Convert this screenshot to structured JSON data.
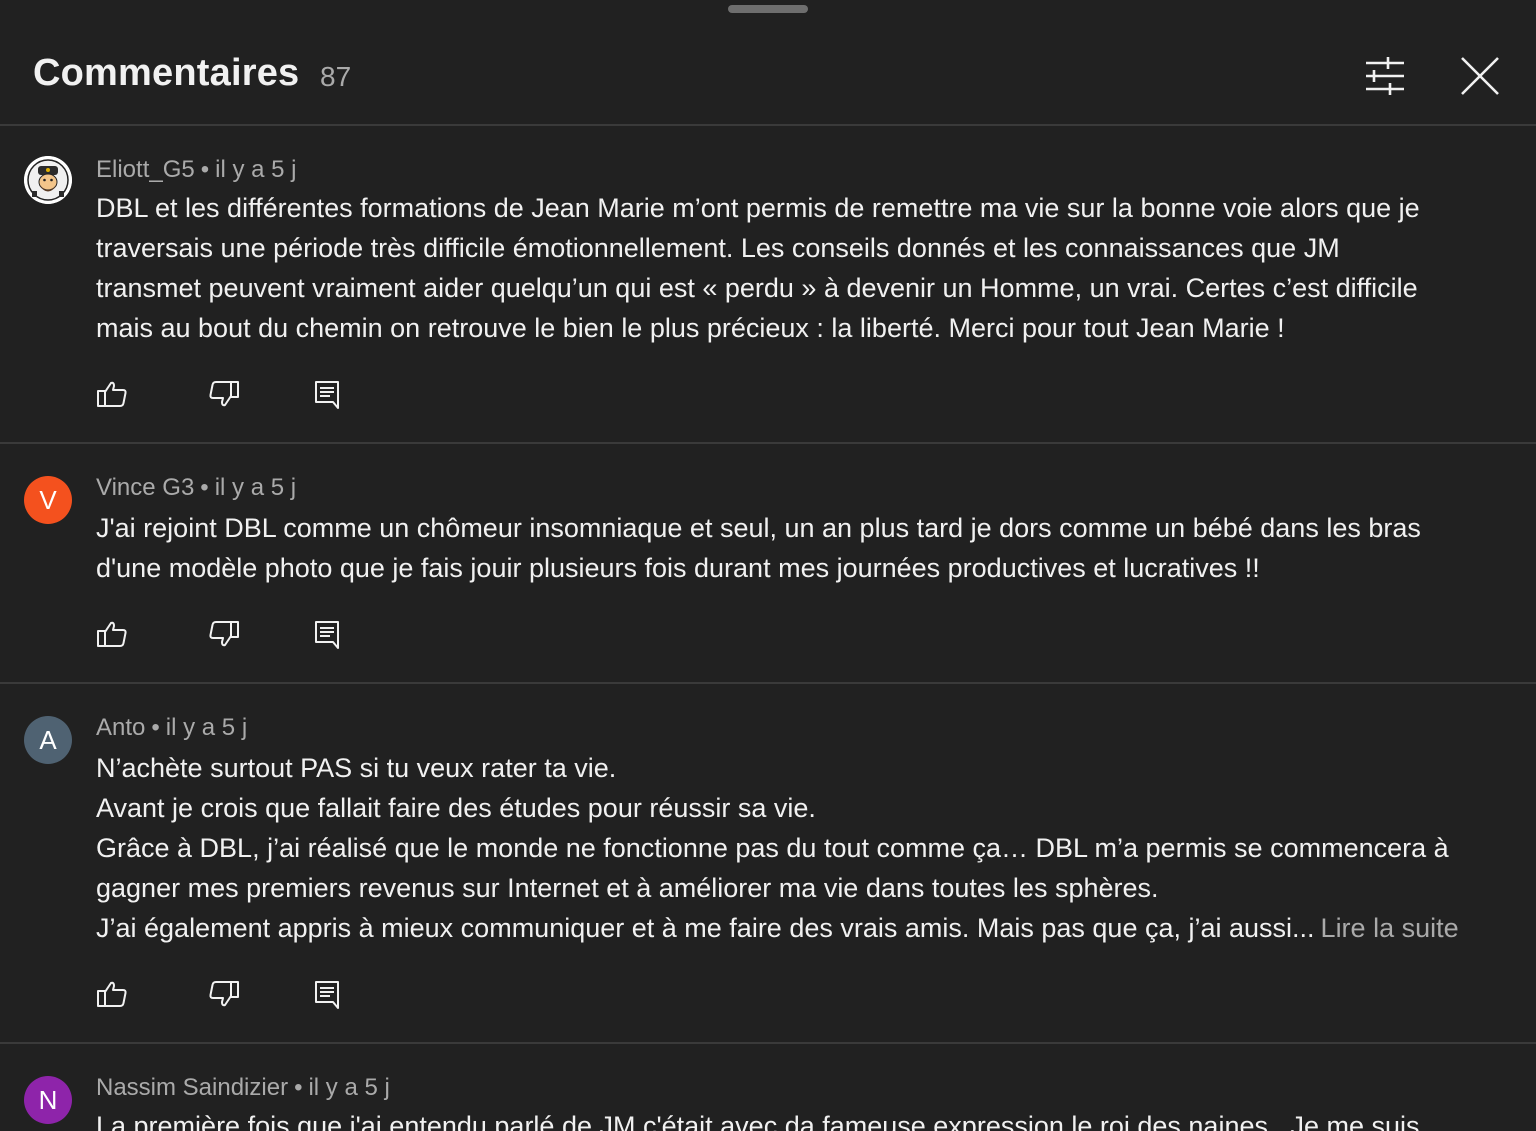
{
  "header": {
    "title": "Commentaires",
    "count": "87"
  },
  "comments": [
    {
      "author": "Eliott_G5",
      "time": "il y a 5 j",
      "avatar_letter": "",
      "avatar_color": "#ffffff",
      "lines": [
        "DBL et les différentes formations de Jean Marie m’ont permis de remettre ma vie sur la bonne voie alors que je",
        "traversais une période très difficile émotionnellement. Les conseils donnés et les connaissances que JM",
        "transmet peuvent vraiment aider quelqu’un qui est « perdu » à devenir un Homme, un vrai. Certes c’est difficile",
        "mais au bout du chemin on retrouve le bien le plus précieux : la liberté. Merci pour tout Jean Marie !"
      ]
    },
    {
      "author": "Vince G3",
      "time": "il y a 5 j",
      "avatar_letter": "V",
      "avatar_color": "#f4511e",
      "lines": [
        "J'ai rejoint DBL comme un chômeur insomniaque et seul, un an plus tard je dors comme un bébé dans les bras",
        "d'une modèle photo que je fais jouir plusieurs fois durant mes journées productives et lucratives !!"
      ]
    },
    {
      "author": "Anto",
      "time": "il y a 5 j",
      "avatar_letter": "A",
      "avatar_color": "#4f6272",
      "lines": [
        "N’achète surtout PAS si tu veux rater ta vie.",
        "Avant je crois que fallait faire des études pour réussir sa vie.",
        "Grâce à DBL, j’ai réalisé que le monde ne fonctionne pas du tout comme ça… DBL m’a permis se commencera à",
        "gagner mes premiers revenus sur Internet et à améliorer ma vie dans toutes les sphères.",
        "J’ai également appris à mieux communiquer et à me faire des vrais amis. Mais pas que ça, j’ai aussi..."
      ],
      "read_more": "Lire la suite"
    },
    {
      "author": "Nassim Saindizier",
      "time": "il y a 5 j",
      "avatar_letter": "N",
      "avatar_color": "#8e24aa",
      "lines": [
        "La première fois que j'ai entendu parlé de  JM c'était avec da fameuse expression le roi des naines . Je me suis"
      ]
    }
  ],
  "meta_separator": "•"
}
